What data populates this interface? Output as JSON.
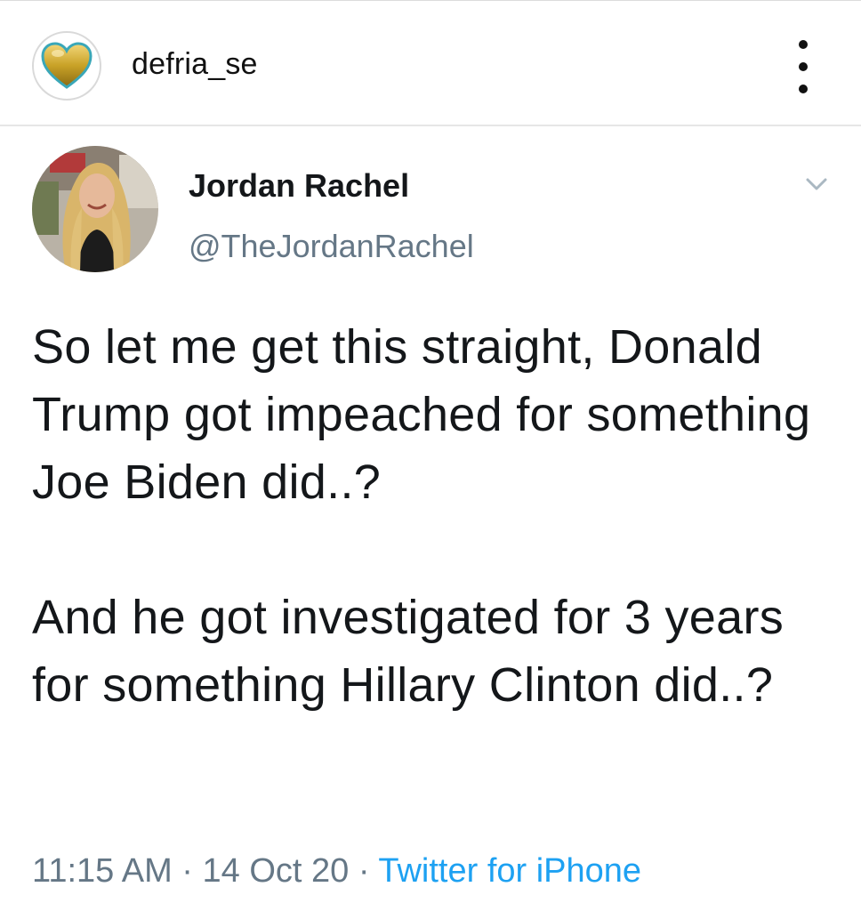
{
  "instagram": {
    "username": "defria_se",
    "avatar_icon": "gold-heart-icon",
    "more_icon": "vertical-ellipsis-icon"
  },
  "tweet": {
    "display_name": "Jordan Rachel",
    "handle": "@TheJordanRachel",
    "caret_icon": "chevron-down-icon",
    "paragraph_1": "So let me get this straight, Donald Trump got impeached for something Joe Biden did..?",
    "paragraph_2": "And he got investigated for 3 years for something Hillary Clinton did..?",
    "time": "11:15 AM",
    "separator_1": "·",
    "date": "14 Oct 20",
    "separator_2": "·",
    "source": "Twitter for iPhone"
  },
  "colors": {
    "text_primary": "#14171a",
    "text_secondary": "#657786",
    "link_blue": "#1da1f2",
    "heart_gold": "#c9a227",
    "heart_outline": "#3aa7b8"
  }
}
